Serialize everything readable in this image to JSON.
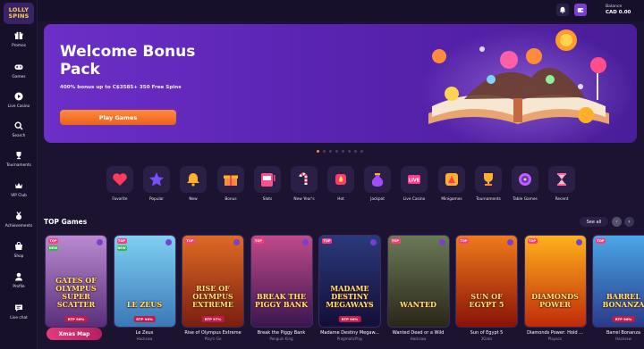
{
  "brand": {
    "line1": "LOLLY",
    "line2": "SPINS"
  },
  "sidebar": {
    "items": [
      {
        "label": "Promos",
        "icon": "gift-icon"
      },
      {
        "label": "Games",
        "icon": "gamepad-icon"
      },
      {
        "label": "Live Casino",
        "icon": "play-icon"
      },
      {
        "label": "Search",
        "icon": "search-icon"
      },
      {
        "label": "Tournaments",
        "icon": "trophy-icon"
      },
      {
        "label": "VIP Club",
        "icon": "crown-icon"
      },
      {
        "label": "Achievements",
        "icon": "medal-icon"
      },
      {
        "label": "Shop",
        "icon": "shop-icon"
      },
      {
        "label": "Profile",
        "icon": "user-icon"
      },
      {
        "label": "Live chat",
        "icon": "chat-icon"
      }
    ]
  },
  "header": {
    "balance_label": "Balance",
    "balance_value": "CAD 0.00",
    "bell_icon": "bell-icon",
    "wallet_icon": "wallet-icon"
  },
  "banner": {
    "title": "Welcome Bonus Pack",
    "subtitle": "400% bonus up to C$3585+ 350 Free Spins",
    "cta": "Play Games",
    "slide_count": 8,
    "active_slide": 1
  },
  "categories": [
    {
      "label": "Favorite",
      "icon": "heart-icon"
    },
    {
      "label": "Popular",
      "icon": "star-icon"
    },
    {
      "label": "New",
      "icon": "bell-icon"
    },
    {
      "label": "Bonus",
      "icon": "gift-box-icon"
    },
    {
      "label": "Slots",
      "icon": "slot-machine-icon"
    },
    {
      "label": "New Year's",
      "icon": "candy-icon"
    },
    {
      "label": "Hot",
      "icon": "fire-icon"
    },
    {
      "label": "Jackpot",
      "icon": "money-bag-icon"
    },
    {
      "label": "Live Casino",
      "icon": "live-icon"
    },
    {
      "label": "Minigames",
      "icon": "minigame-icon"
    },
    {
      "label": "Tournaments",
      "icon": "trophy-icon"
    },
    {
      "label": "Table Games",
      "icon": "roulette-icon"
    },
    {
      "label": "Recent",
      "icon": "hourglass-icon"
    }
  ],
  "section": {
    "title": "TOP Games",
    "see_all": "See all",
    "prev": "‹",
    "next": "›"
  },
  "games": [
    {
      "name": "",
      "provider": "",
      "top": "TOP",
      "new": "NEW",
      "art": "GATES OF OLYMPUS SUPER SCATTER",
      "rtp": "RTP 96%",
      "bg1": "#b98ad0",
      "bg2": "#5a2f7a"
    },
    {
      "name": "Le Zeus",
      "provider": "Hacksaw",
      "top": "TOP",
      "new": "NEW",
      "art": "LE ZEUS",
      "rtp": "RTP 96%",
      "bg1": "#7fd0f2",
      "bg2": "#3a78b8"
    },
    {
      "name": "Rise of Olympus Extreme",
      "provider": "Play'n Go",
      "top": "TOP",
      "new": "",
      "art": "RISE OF OLYMPUS EXTREME",
      "rtp": "RTP 97%",
      "bg1": "#e06a24",
      "bg2": "#7a1e10"
    },
    {
      "name": "Break the Piggy Bank",
      "provider": "Penguin King",
      "top": "TOP",
      "new": "",
      "art": "BREAK THE PIGGY BANK",
      "rtp": "",
      "bg1": "#c14a8a",
      "bg2": "#3a1650"
    },
    {
      "name": "Madame Destiny Megaw...",
      "provider": "PragmaticPlay",
      "top": "TOP",
      "new": "",
      "art": "MADAME DESTINY MEGAWAYS",
      "rtp": "RTP 96%",
      "bg1": "#2a3a7a",
      "bg2": "#140e38"
    },
    {
      "name": "Wanted Dead or a Wild",
      "provider": "Hacksaw",
      "top": "TOP",
      "new": "",
      "art": "WANTED",
      "rtp": "",
      "bg1": "#6a7a56",
      "bg2": "#2a2618"
    },
    {
      "name": "Sun of Egypt 5",
      "provider": "3Oaks",
      "top": "TOP",
      "new": "",
      "art": "SUN OF EGYPT 5",
      "rtp": "",
      "bg1": "#f07a1a",
      "bg2": "#8a1208"
    },
    {
      "name": "Diamonds Power: Hold ...",
      "provider": "Playson",
      "top": "TOP",
      "new": "",
      "art": "DIAMONDS POWER",
      "rtp": "",
      "bg1": "#ffb21a",
      "bg2": "#c02a0a"
    },
    {
      "name": "Barrel Bonanza",
      "provider": "Hacksaw",
      "top": "TOP",
      "new": "",
      "art": "BARREL BONANZA",
      "rtp": "RTP 96%",
      "bg1": "#4aa8e8",
      "bg2": "#2a3a8a"
    }
  ],
  "xmas_map": "Xmas Map",
  "colors": {
    "background": "#1b1330",
    "sidebar": "#17102b",
    "accent": "#ff8b3c",
    "banner": "#6c2fc8",
    "tile": "#2a1f45"
  }
}
